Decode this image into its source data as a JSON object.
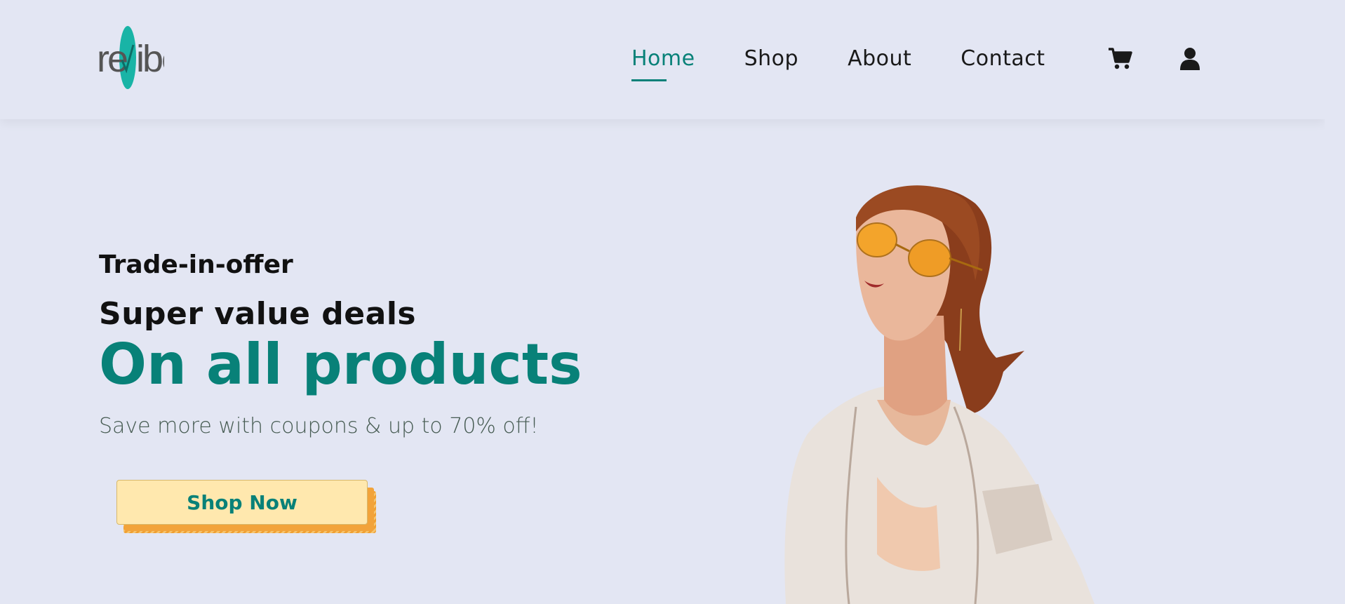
{
  "brand": {
    "logo_alt": "reVibe logo",
    "accent_color": "#088178",
    "background_color": "#e3e6f3"
  },
  "nav": {
    "items": [
      {
        "label": "Home",
        "active": true
      },
      {
        "label": "Shop",
        "active": false
      },
      {
        "label": "About",
        "active": false
      },
      {
        "label": "Contact",
        "active": false
      }
    ],
    "cart_icon": "cart-icon",
    "user_icon": "user-icon"
  },
  "hero": {
    "subtitle": "Trade-in-offer",
    "heading": "Super value deals",
    "title": "On all products",
    "description": "Save more with coupons & up to 70% off!",
    "button_label": "Shop Now",
    "button_color": "#ffe8ae",
    "image_alt": "Model wearing orange sunglasses and a white shirt"
  }
}
